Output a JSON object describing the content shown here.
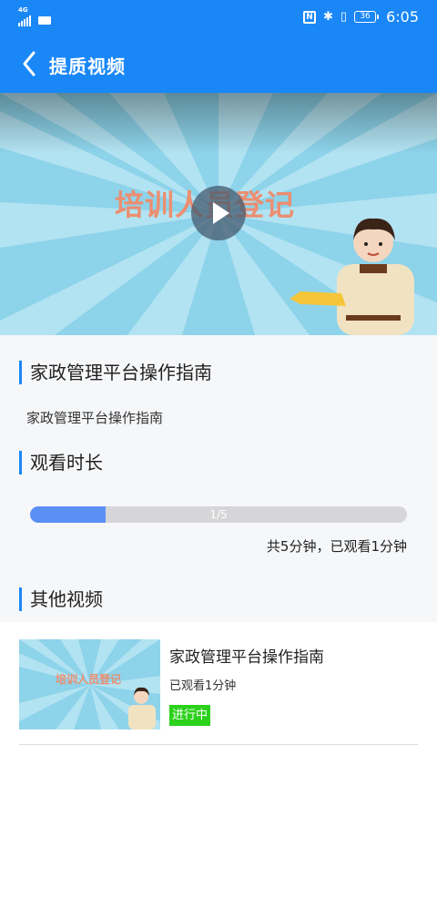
{
  "status_bar": {
    "network": "4G",
    "time": "6:05",
    "battery": "36",
    "nfc": "N"
  },
  "header": {
    "title": "提质视频",
    "back_icon": "chevron-left-icon"
  },
  "video": {
    "poster_text": "培训人员登记",
    "play_icon": "play-icon"
  },
  "course": {
    "title": "家政管理平台操作指南",
    "description": "家政管理平台操作指南"
  },
  "watch": {
    "heading": "观看时长",
    "progress_label": "1/5",
    "progress_fraction": 0.2,
    "caption": "共5分钟，已观看1分钟"
  },
  "others": {
    "heading": "其他视频",
    "items": [
      {
        "title": "家政管理平台操作指南",
        "thumb_text": "培训人员登记",
        "watched": "已观看1分钟",
        "status": "进行中"
      }
    ]
  },
  "colors": {
    "brand": "#1a87f7",
    "progress": "#5b8ff6",
    "status_badge": "#2bd11a"
  }
}
